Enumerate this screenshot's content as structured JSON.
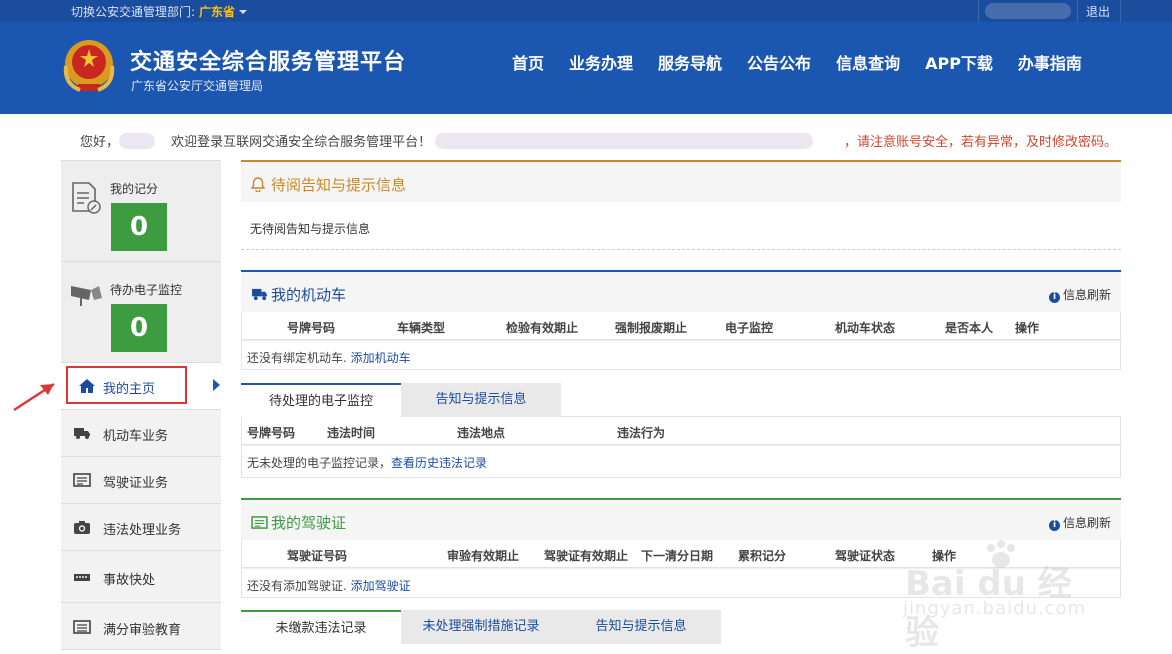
{
  "topbar": {
    "dept_label": "切换公安交通管理部门:",
    "dept_value": "广东省",
    "logout": "退出"
  },
  "header": {
    "title": "交通安全综合服务管理平台",
    "subtitle": "广东省公安厅交通管理局",
    "nav": [
      "首页",
      "业务办理",
      "服务导航",
      "公告公布",
      "信息查询",
      "APP下载",
      "办事指南"
    ]
  },
  "welcome": {
    "greeting": "您好，",
    "text": "欢迎登录互联网交通安全综合服务管理平台！",
    "warning": "，请注意账号安全，若有异常，及时修改密码。"
  },
  "sidebar": {
    "score_label": "我的记分",
    "score_value": "0",
    "monitor_label": "待办电子监控",
    "monitor_value": "0",
    "items": [
      {
        "label": "我的主页",
        "icon": "home-icon"
      },
      {
        "label": "机动车业务",
        "icon": "truck-icon"
      },
      {
        "label": "驾驶证业务",
        "icon": "card-icon"
      },
      {
        "label": "违法处理业务",
        "icon": "camera-icon"
      },
      {
        "label": "事故快处",
        "icon": "accident-icon"
      },
      {
        "label": "满分审验教育",
        "icon": "list-icon"
      }
    ]
  },
  "notice": {
    "title": "待阅告知与提示信息",
    "empty": "无待阅告知与提示信息"
  },
  "vehicles": {
    "title": "我的机动车",
    "refresh": "信息刷新",
    "columns": [
      "号牌号码",
      "车辆类型",
      "检验有效期止",
      "强制报废期止",
      "电子监控",
      "机动车状态",
      "是否本人",
      "操作"
    ],
    "empty_text": "还没有绑定机动车. ",
    "empty_link": "添加机动车"
  },
  "monitor_tabs": {
    "tabs": [
      "待处理的电子监控",
      "告知与提示信息"
    ],
    "columns": [
      "号牌号码",
      "违法时间",
      "违法地点",
      "违法行为"
    ],
    "empty_text": "无未处理的电子监控记录，",
    "empty_link": "查看历史违法记录"
  },
  "license": {
    "title": "我的驾驶证",
    "refresh": "信息刷新",
    "columns": [
      "驾驶证号码",
      "审验有效期止",
      "驾驶证有效期止",
      "下一清分日期",
      "累积记分",
      "驾驶证状态",
      "操作"
    ],
    "empty_text": "还没有添加驾驶证. ",
    "empty_link": "添加驾驶证"
  },
  "bottom_tabs": {
    "tabs": [
      "未缴款违法记录",
      "未处理强制措施记录",
      "告知与提示信息"
    ]
  },
  "watermark": {
    "brand": "Bai du 经验",
    "url": "jingyan.baidu.com"
  },
  "colors": {
    "header_bg": "#1b56b0",
    "score_green": "#3c9c3f",
    "notice_orange": "#c9892a",
    "warning_red": "#d2452d"
  }
}
